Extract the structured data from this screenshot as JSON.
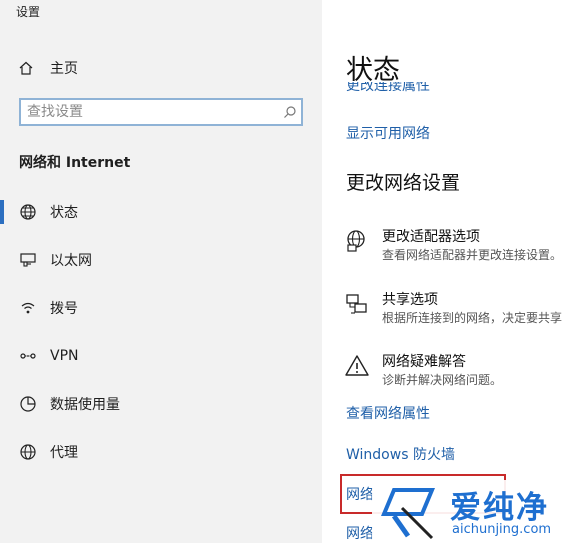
{
  "window": {
    "title": "设置"
  },
  "sidebar": {
    "home_label": "主页",
    "search": {
      "placeholder": "查找设置",
      "value": ""
    },
    "section_title": "网络和 Internet",
    "items": [
      {
        "label": "状态",
        "icon": "globe-icon",
        "active": true
      },
      {
        "label": "以太网",
        "icon": "ethernet-icon",
        "active": false
      },
      {
        "label": "拨号",
        "icon": "dialup-icon",
        "active": false
      },
      {
        "label": "VPN",
        "icon": "vpn-icon",
        "active": false
      },
      {
        "label": "数据使用量",
        "icon": "data-usage-icon",
        "active": false
      },
      {
        "label": "代理",
        "icon": "proxy-icon",
        "active": false
      }
    ]
  },
  "main": {
    "title": "状态",
    "cut_link": "更改连接属性",
    "show_networks_link": "显示可用网络",
    "change_settings_heading": "更改网络设置",
    "options": [
      {
        "title": "更改适配器选项",
        "desc": "查看网络适配器并更改连接设置。",
        "icon": "adapter-icon"
      },
      {
        "title": "共享选项",
        "desc": "根据所连接到的网络，决定要共享",
        "icon": "sharing-icon"
      },
      {
        "title": "网络疑难解答",
        "desc": "诊断并解决网络问题。",
        "icon": "warning-icon"
      }
    ],
    "view_properties_link": "查看网络属性",
    "firewall_link": "Windows 防火墙",
    "network_link_1": "网络",
    "network_link_2": "网络"
  },
  "watermark": {
    "brand": "爱纯净",
    "site": "aichunjing.com"
  },
  "colors": {
    "accent": "#2c6fc0",
    "link": "#1f5fa8",
    "highlight_box": "#c82a2a",
    "watermark": "#1e6fd0"
  }
}
